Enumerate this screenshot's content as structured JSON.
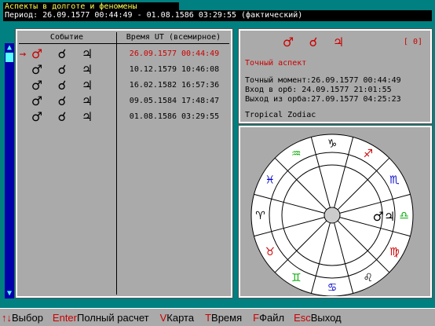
{
  "window": {
    "title": "Аспекты в долготе и феномены",
    "period": "Период: 26.09.1577 00:44:49 - 01.08.1586 03:29:55 (фактический)"
  },
  "events_table": {
    "col_event": "Событие",
    "col_time": "Время UT (всемирное)",
    "pointer_glyph": "→",
    "rows": [
      {
        "glyph1": "♂",
        "glyph2": "☌",
        "glyph3": "♃",
        "time": "26.09.1577 00:44:49"
      },
      {
        "glyph1": "♂",
        "glyph2": "☌",
        "glyph3": "♃",
        "time": "10.12.1579 10:46:08"
      },
      {
        "glyph1": "♂",
        "glyph2": "☌",
        "glyph3": "♃",
        "time": "16.02.1582 16:57:36"
      },
      {
        "glyph1": "♂",
        "glyph2": "☌",
        "glyph3": "♃",
        "time": "09.05.1584 17:48:47"
      },
      {
        "glyph1": "♂",
        "glyph2": "☌",
        "glyph3": "♃",
        "time": "01.08.1586 03:29:55"
      }
    ],
    "selected_index": 0
  },
  "aspect_info": {
    "glyph1": "♂",
    "glyph2": "☌",
    "glyph3": "♃",
    "orb": "[ 0]",
    "aspect_name": "Точный аспект",
    "exact_moment": "Точный момент:26.09.1577 00:44:49",
    "orb_entry": "Вход в орб:   24.09.1577 21:01:55",
    "orb_exit": "Выход из орба:27.09.1577 04:25:23",
    "zodiac": "Tropical Zodiac"
  },
  "zodiac_wheel": {
    "signs": [
      "♑",
      "♐",
      "♏",
      "♎",
      "♍",
      "♌",
      "♋",
      "♊",
      "♉",
      "♈",
      "♓",
      "♒"
    ],
    "sign_colors": [
      "#000000",
      "#cc0000",
      "#0000cc",
      "#00aa00",
      "#cc0000",
      "#000000",
      "#0000cc",
      "#00aa00",
      "#cc0000",
      "#000000",
      "#0000cc",
      "#00aa00"
    ],
    "planet_glyph": "♂♃"
  },
  "statusbar": {
    "hints": [
      {
        "key": "↑↓",
        "label": "Выбор"
      },
      {
        "key": "Enter",
        "label": "Полный расчет"
      },
      {
        "key": "V",
        "label": "Карта"
      },
      {
        "key": "T",
        "label": "Время"
      },
      {
        "key": "F",
        "label": "Файл"
      },
      {
        "key": "Esc",
        "label": "Выход"
      }
    ]
  }
}
